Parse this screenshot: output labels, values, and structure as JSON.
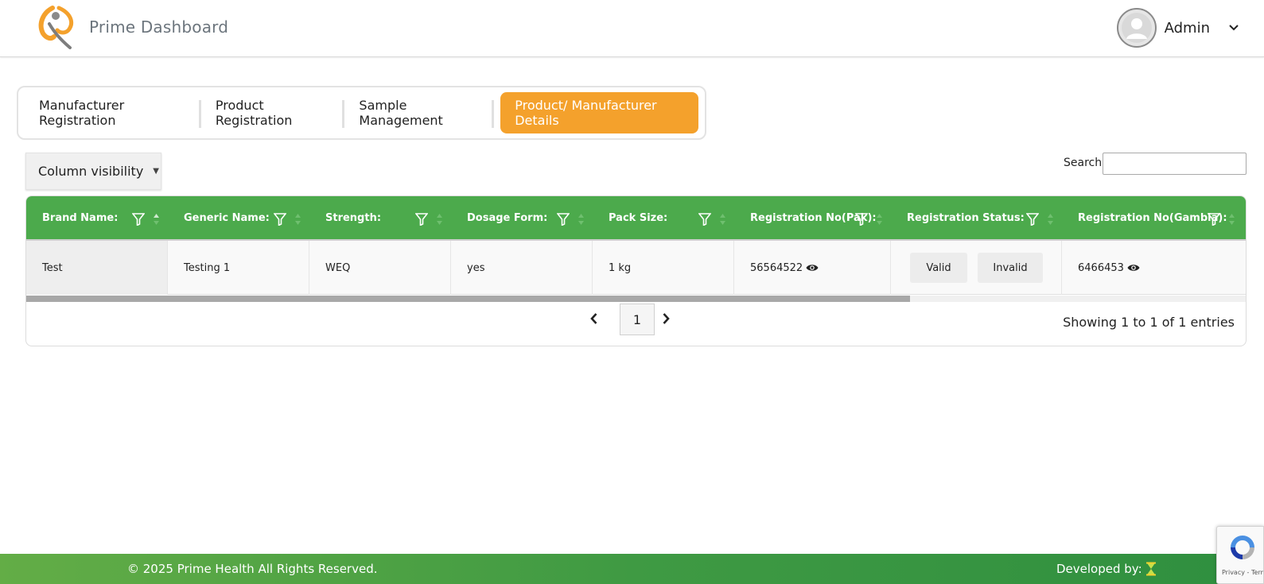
{
  "header": {
    "title": "Prime Dashboard",
    "user_name": "Admin",
    "icons": {
      "logo": "prime-health-logo",
      "avatar": "user-avatar-icon",
      "dropdown": "chevron-down-icon"
    }
  },
  "tabs": [
    {
      "label": "Manufacturer Registration",
      "active": false
    },
    {
      "label": "Product Registration",
      "active": false
    },
    {
      "label": "Sample Management",
      "active": false
    },
    {
      "label": "Product/ Manufacturer Details",
      "active": true
    }
  ],
  "toolbar": {
    "column_visibility_label": "Column visibility"
  },
  "search": {
    "label": "Search:",
    "value": ""
  },
  "table": {
    "columns": [
      "Brand Name:",
      "Generic Name:",
      "Strength:",
      "Dosage Form:",
      "Pack Size:",
      "Registration No(Pak):",
      "Registration Status:",
      "Registration No(Gambia):"
    ],
    "row": {
      "brand_name": "Test",
      "generic_name": "Testing 1",
      "strength": "WEQ",
      "dosage_form": "yes",
      "pack_size": "1 kg",
      "registration_no_pak": "56564522",
      "status_valid_label": "Valid",
      "status_invalid_label": "Invalid",
      "registration_no_gambia": "6466453"
    }
  },
  "pagination": {
    "current_page": "1",
    "info": "Showing 1 to 1 of 1 entries"
  },
  "footer": {
    "copyright": "© 2025 Prime Health All Rights Reserved.",
    "developed_by": "Developed by:"
  },
  "recaptcha": {
    "text": "Privacy - Terms"
  },
  "colors": {
    "accent": "#f4a12c",
    "table_header": "#4caa4c",
    "footer_start": "#63ad46",
    "footer_end": "#2f8f3f"
  }
}
